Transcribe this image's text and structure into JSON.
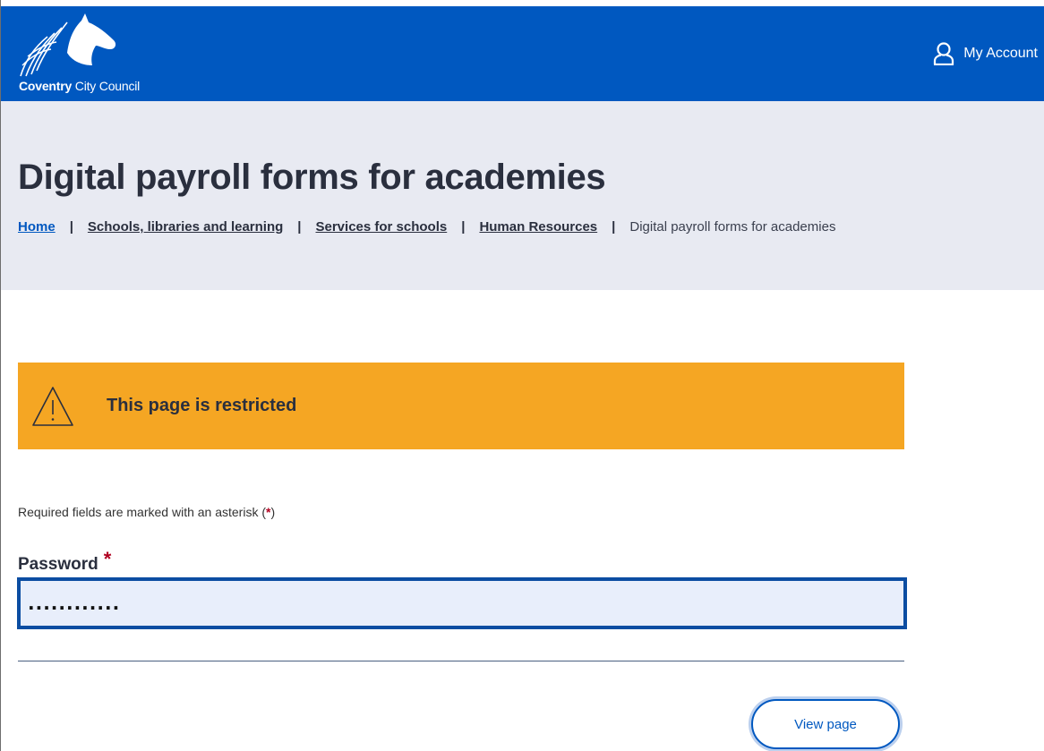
{
  "header": {
    "logo_brand": "Coventry",
    "logo_rest": " City Council",
    "account_label": "My Account",
    "brand_color": "#0058c0"
  },
  "page": {
    "title": "Digital payroll forms for academies"
  },
  "breadcrumb": {
    "items": [
      {
        "label": "Home",
        "link": true
      },
      {
        "label": "Schools, libraries and learning",
        "link": true
      },
      {
        "label": "Services for schools",
        "link": true
      },
      {
        "label": "Human Resources",
        "link": true
      },
      {
        "label": "Digital payroll forms for academies",
        "link": false
      }
    ],
    "separator": "|"
  },
  "warning": {
    "text": "This page is restricted",
    "icon": "warning-triangle-icon",
    "color": "#f5a623"
  },
  "form": {
    "required_note_prefix": "Required fields are marked with an asterisk (",
    "required_note_asterisk": "*",
    "required_note_suffix": ")",
    "password_label": "Password",
    "password_required_mark": "*",
    "password_value": "............",
    "submit_label": "View page"
  }
}
